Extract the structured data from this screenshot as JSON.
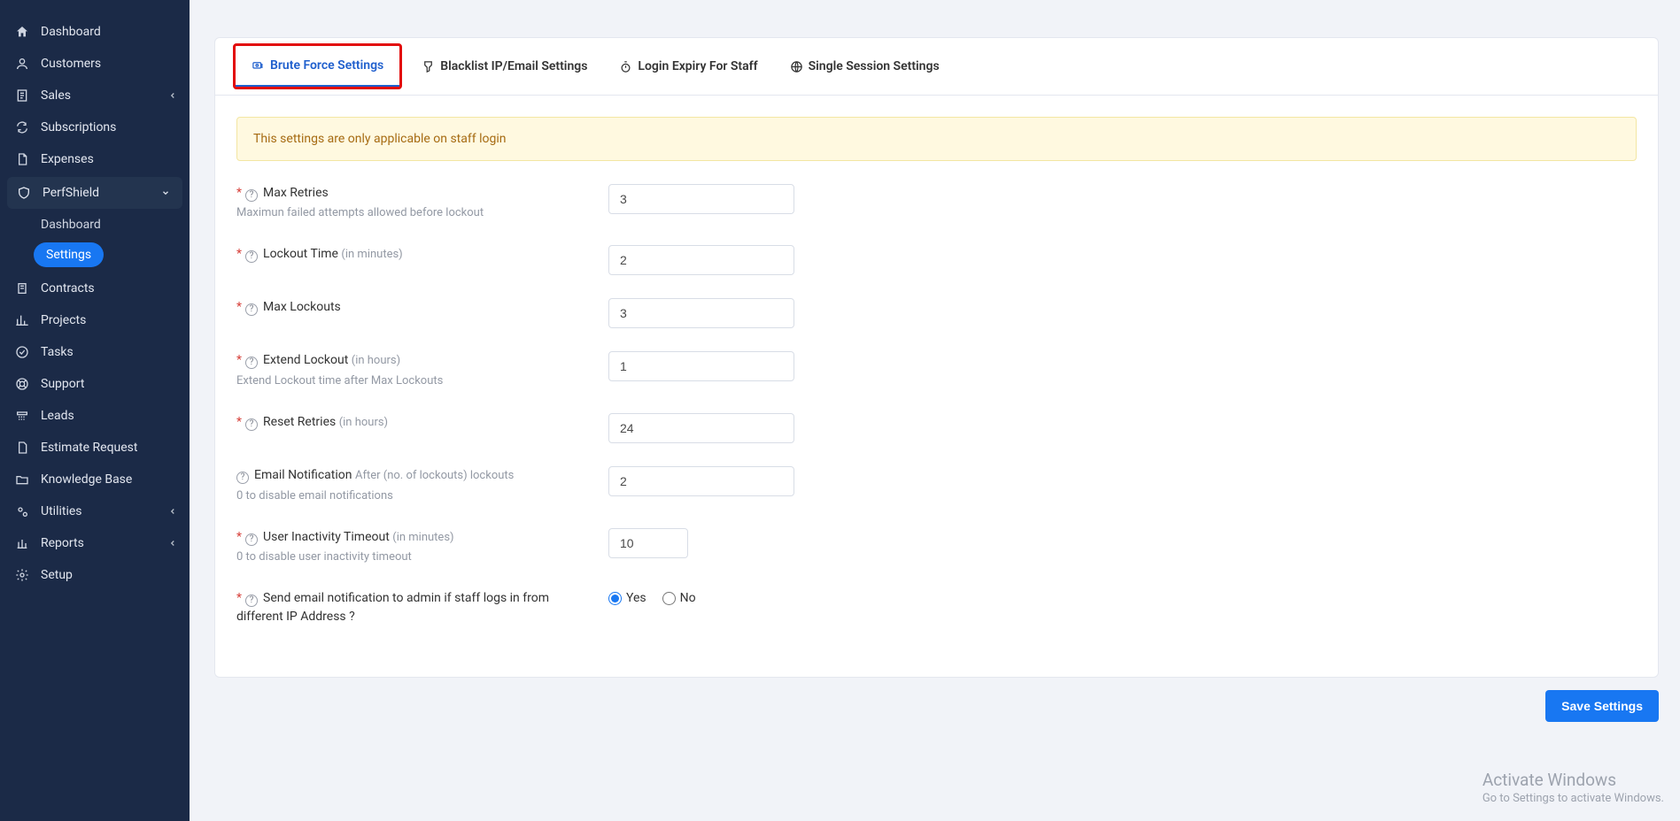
{
  "sidebar": {
    "items": [
      {
        "label": "Dashboard"
      },
      {
        "label": "Customers"
      },
      {
        "label": "Sales"
      },
      {
        "label": "Subscriptions"
      },
      {
        "label": "Expenses"
      },
      {
        "label": "PerfShield"
      },
      {
        "label": "Contracts"
      },
      {
        "label": "Projects"
      },
      {
        "label": "Tasks"
      },
      {
        "label": "Support"
      },
      {
        "label": "Leads"
      },
      {
        "label": "Estimate Request"
      },
      {
        "label": "Knowledge Base"
      },
      {
        "label": "Utilities"
      },
      {
        "label": "Reports"
      },
      {
        "label": "Setup"
      }
    ],
    "sub": {
      "dashboard": "Dashboard",
      "settings": "Settings"
    }
  },
  "tabs": {
    "brute": "Brute Force Settings",
    "blacklist": "Blacklist IP/Email Settings",
    "expiry": "Login Expiry For Staff",
    "session": "Single Session Settings"
  },
  "alert": "This settings are only applicable on staff login",
  "form": {
    "max_retries": {
      "label": "Max Retries",
      "under": "Maximun failed attempts allowed before lockout",
      "value": "3"
    },
    "lockout_time": {
      "label": "Lockout Time ",
      "hint": "(in minutes)",
      "value": "2"
    },
    "max_lockouts": {
      "label": "Max Lockouts",
      "value": "3"
    },
    "extend_lockout": {
      "label": "Extend Lockout ",
      "hint": "(in hours)",
      "under": "Extend Lockout time after Max Lockouts",
      "value": "1"
    },
    "reset_retries": {
      "label": "Reset Retries ",
      "hint": "(in hours)",
      "value": "24"
    },
    "email_notif": {
      "label": "Email Notification ",
      "hint": "After (no. of lockouts) lockouts",
      "under": "0 to disable email notifications",
      "value": "2"
    },
    "inactivity": {
      "label": "User Inactivity Timeout ",
      "hint": "(in minutes)",
      "under": "0 to disable user inactivity timeout",
      "value": "10"
    },
    "send_email": {
      "label": "Send email notification to admin if staff logs in from different IP Address ?",
      "yes": "Yes",
      "no": "No"
    }
  },
  "buttons": {
    "save": "Save Settings"
  },
  "watermark": {
    "t1": "Activate Windows",
    "t2": "Go to Settings to activate Windows."
  }
}
